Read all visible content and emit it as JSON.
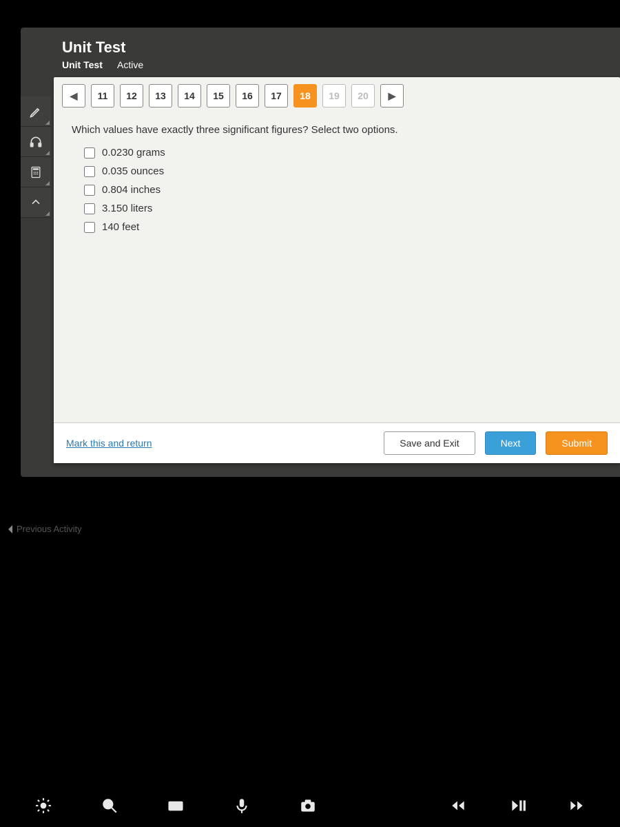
{
  "header": {
    "title": "Unit Test",
    "subtitle": "Unit Test",
    "status": "Active"
  },
  "nav": {
    "items": [
      {
        "n": "11"
      },
      {
        "n": "12"
      },
      {
        "n": "13"
      },
      {
        "n": "14"
      },
      {
        "n": "15"
      },
      {
        "n": "16"
      },
      {
        "n": "17"
      },
      {
        "n": "18",
        "current": true
      },
      {
        "n": "19",
        "dim": true
      },
      {
        "n": "20",
        "dim": true
      }
    ]
  },
  "question": {
    "prompt": "Which values have exactly three significant figures? Select two options.",
    "options": [
      {
        "label": "0.0230 grams"
      },
      {
        "label": "0.035 ounces"
      },
      {
        "label": "0.804 inches"
      },
      {
        "label": "3.150 liters"
      },
      {
        "label": "140 feet"
      }
    ]
  },
  "footer": {
    "mark": "Mark this and return",
    "save": "Save and Exit",
    "next": "Next",
    "submit": "Submit"
  },
  "previous_activity": "Previous Activity"
}
